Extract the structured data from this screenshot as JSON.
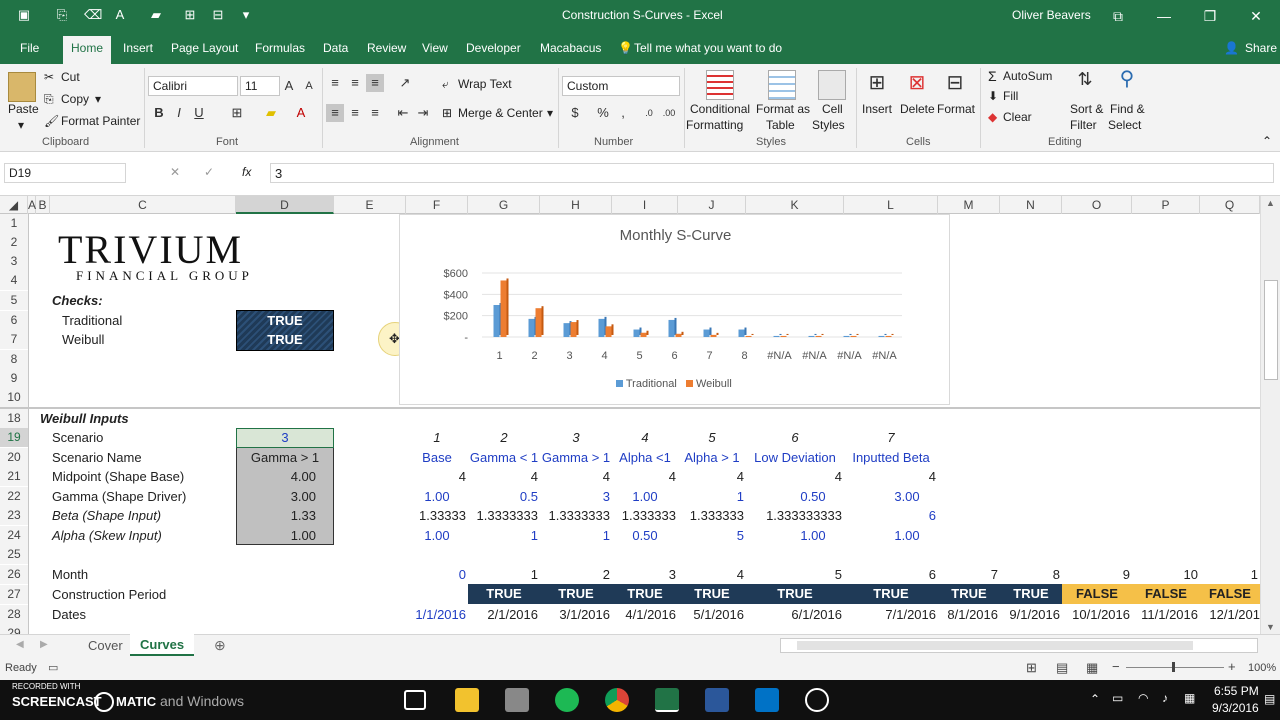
{
  "window": {
    "title": "Construction S-Curves - Excel",
    "user": "Oliver Beavers"
  },
  "menu_tabs": [
    "File",
    "Home",
    "Insert",
    "Page Layout",
    "Formulas",
    "Data",
    "Review",
    "View",
    "Developer",
    "Macabacus"
  ],
  "tell_me": "Tell me what you want to do",
  "share": "Share",
  "ribbon": {
    "clipboard": {
      "paste": "Paste",
      "cut": "Cut",
      "copy": "Copy",
      "format_painter": "Format Painter",
      "group": "Clipboard"
    },
    "font": {
      "name": "Calibri",
      "size": "11",
      "group": "Font"
    },
    "alignment": {
      "wrap": "Wrap Text",
      "merge": "Merge & Center",
      "group": "Alignment"
    },
    "number": {
      "format": "Custom",
      "group": "Number"
    },
    "styles": {
      "cond": "Conditional Formatting",
      "cond1": "Conditional",
      "cond2": "Formatting",
      "fmt1": "Format as",
      "fmt2": "Table",
      "cell1": "Cell",
      "cell2": "Styles",
      "group": "Styles"
    },
    "cells": {
      "insert": "Insert",
      "delete": "Delete",
      "format": "Format",
      "group": "Cells"
    },
    "editing": {
      "autosum": "AutoSum",
      "fill": "Fill",
      "clear": "Clear",
      "sort1": "Sort &",
      "sort2": "Filter",
      "find1": "Find &",
      "find2": "Select",
      "group": "Editing"
    }
  },
  "formula_bar": {
    "name_box": "D19",
    "fx": "fx",
    "value": "3"
  },
  "columns": [
    "A",
    "B",
    "C",
    "D",
    "E",
    "F",
    "G",
    "H",
    "I",
    "J",
    "K",
    "L",
    "M",
    "N",
    "O",
    "P",
    "Q"
  ],
  "rows": [
    "1",
    "2",
    "3",
    "4",
    "5",
    "6",
    "7",
    "8",
    "9",
    "10",
    "18",
    "19",
    "20",
    "21",
    "22",
    "23",
    "24",
    "25",
    "26",
    "27",
    "28",
    "29"
  ],
  "logo": {
    "name": "TRIVIUM",
    "sub": "FINANCIAL GROUP"
  },
  "checks": {
    "title": "Checks:",
    "traditional": "Traditional",
    "weibull": "Weibull",
    "trad_val": "TRUE",
    "weib_val": "TRUE"
  },
  "weibull_inputs": {
    "title": "Weibull Inputs",
    "labels": [
      "Scenario",
      "Scenario Name",
      "Midpoint (Shape Base)",
      "Gamma (Shape Driver)",
      "Beta (Shape Input)",
      "Alpha (Skew Input)"
    ],
    "values": [
      "3",
      "Gamma > 1",
      "4.00",
      "3.00",
      "1.33",
      "1.00"
    ]
  },
  "scenarios": {
    "numbers": [
      "1",
      "2",
      "3",
      "4",
      "5",
      "6",
      "7"
    ],
    "names": [
      "Base",
      "Gamma < 1",
      "Gamma > 1",
      "Alpha <1",
      "Alpha > 1",
      "Low Deviation",
      "Inputted Beta"
    ],
    "midpoints": [
      "4",
      "4",
      "4",
      "4",
      "4",
      "4",
      "4"
    ],
    "gammas": [
      "1.00",
      "0.5",
      "3",
      "1.00",
      "1",
      "0.50",
      "3.00"
    ],
    "betas": [
      "1.33333",
      "1.3333333",
      "1.3333333",
      "1.333333",
      "1.333333",
      "1.333333333",
      "6"
    ],
    "alphas": [
      "1.00",
      "1",
      "1",
      "0.50",
      "5",
      "1.00",
      "1.00"
    ]
  },
  "timeline": {
    "month_label": "Month",
    "period_label": "Construction Period",
    "dates_label": "Dates",
    "months": [
      "0",
      "1",
      "2",
      "3",
      "4",
      "5",
      "6",
      "7",
      "8",
      "9",
      "10",
      "1"
    ],
    "period": [
      "TRUE",
      "TRUE",
      "TRUE",
      "TRUE",
      "TRUE",
      "TRUE",
      "TRUE",
      "TRUE",
      "TRUE",
      "FALSE",
      "FALSE",
      "FALSE"
    ],
    "dates": [
      "1/1/2016",
      "2/1/2016",
      "3/1/2016",
      "4/1/2016",
      "5/1/2016",
      "6/1/2016",
      "7/1/2016",
      "8/1/2016",
      "9/1/2016",
      "10/1/2016",
      "11/1/2016",
      "12/1/201"
    ]
  },
  "chart_data": {
    "type": "bar",
    "title": "Monthly S-Curve",
    "categories": [
      "1",
      "2",
      "3",
      "4",
      "5",
      "6",
      "7",
      "8",
      "#N/A",
      "#N/A",
      "#N/A",
      "#N/A"
    ],
    "series": [
      {
        "name": "Traditional",
        "values": [
          300,
          170,
          130,
          170,
          70,
          160,
          70,
          70,
          10,
          10,
          10,
          10
        ]
      },
      {
        "name": "Weibull",
        "values": [
          530,
          270,
          140,
          100,
          40,
          30,
          20,
          10,
          10,
          10,
          10,
          10
        ]
      }
    ],
    "yticks": [
      "$600",
      "$400",
      "$200",
      "-"
    ],
    "ylim": [
      0,
      600
    ],
    "colors": [
      "#5b9bd5",
      "#ed7d31"
    ],
    "legend": "bottom"
  },
  "sheet_tabs": [
    "Cover",
    "Curves"
  ],
  "status": {
    "ready": "Ready",
    "zoom": "100%"
  },
  "taskbar": {
    "search": "and Windows",
    "time": "6:55 PM",
    "date": "9/3/2016",
    "watermark1": "RECORDED WITH",
    "watermark2": "SCREENCAST",
    "watermark3": "MATIC"
  }
}
